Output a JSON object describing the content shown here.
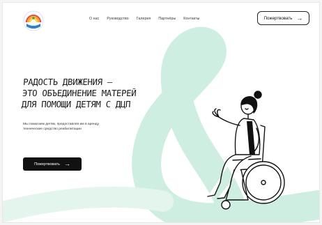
{
  "nav": {
    "items": [
      "О нас",
      "Руководство",
      "Галерея",
      "Партнёры",
      "Контакты"
    ]
  },
  "header": {
    "donate_label": "Пожертвовать"
  },
  "hero": {
    "title_lines": [
      "РАДОСТЬ ДВИЖЕНИЯ —",
      "ЭТО ОБЪЕДИНЕНИЕ МАТЕРЕЙ",
      "ДЛЯ ПОМОЩИ ДЕТЯМ С ДЦП"
    ],
    "description": "Мы помогаем детям, предоставляя им в аренду технические средство реабилитации",
    "donate_label": "Пожертвовать"
  },
  "colors": {
    "accent_mint": "#cdeee0",
    "dark": "#111111"
  },
  "icons": {
    "arrow": "arrow-right-icon",
    "logo": "rainbow-logo-icon"
  }
}
